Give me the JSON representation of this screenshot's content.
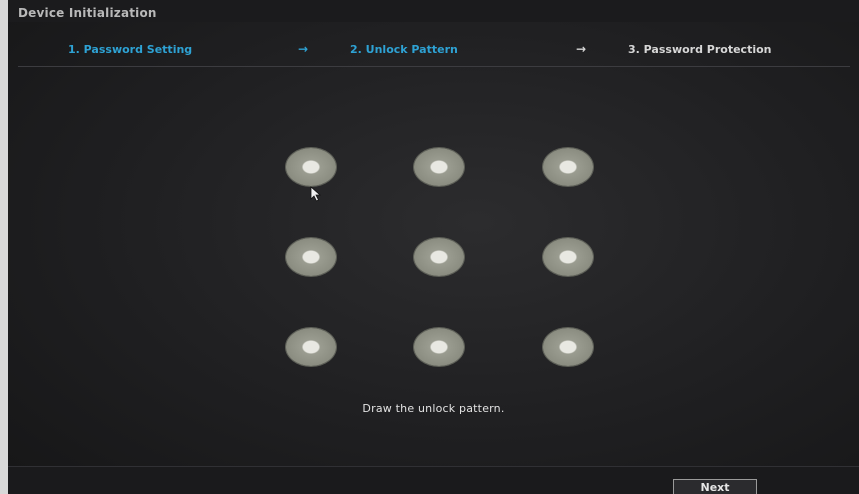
{
  "window": {
    "title": "Device Initialization"
  },
  "steps": [
    {
      "label": "1. Password Setting",
      "state": "active"
    },
    {
      "label": "2. Unlock Pattern",
      "state": "active"
    },
    {
      "label": "3. Password Protection",
      "state": "pending"
    }
  ],
  "arrows": [
    "→",
    "→"
  ],
  "pattern": {
    "rows": 3,
    "cols": 3,
    "dot_count": 9,
    "hint": "Draw the unlock pattern."
  },
  "footer": {
    "next_label": "Next"
  },
  "colors": {
    "active_step": "#2ea2d4",
    "pending_step": "#d7d7d7",
    "background": "#1f1f21",
    "dot": "#8e9084"
  }
}
